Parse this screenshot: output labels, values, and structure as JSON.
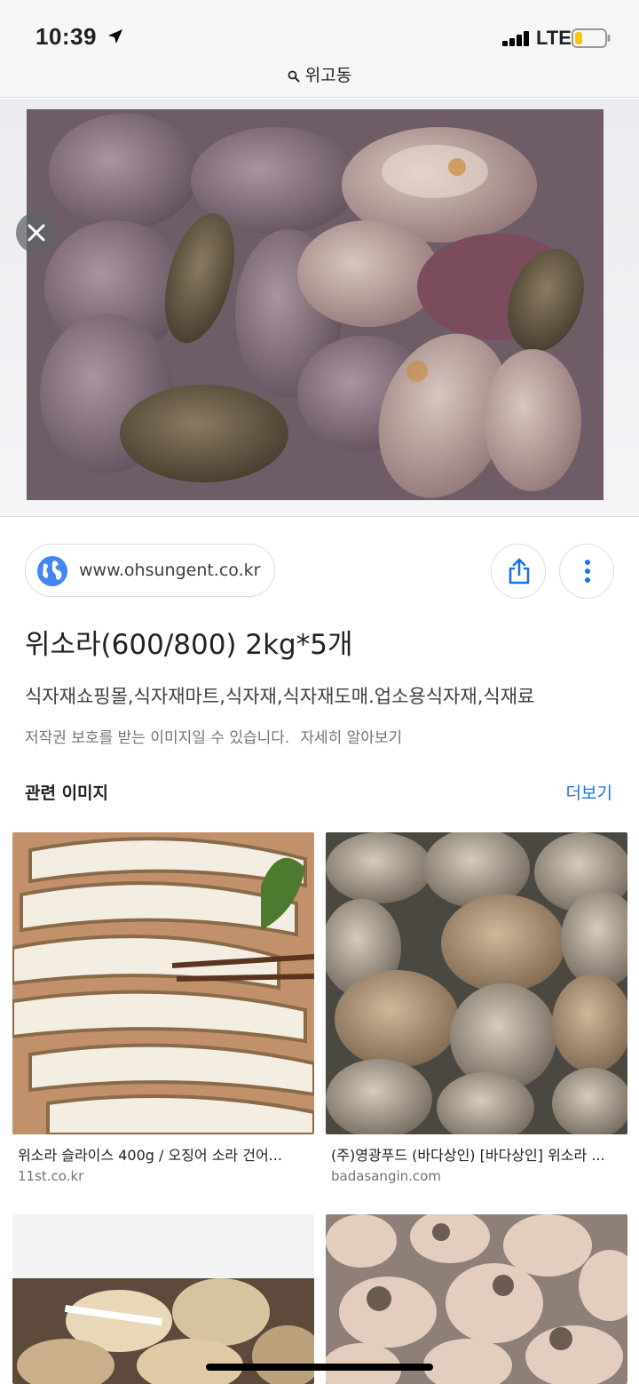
{
  "status_bar": {
    "time": "10:39",
    "carrier": "LTE",
    "battery_level": 0.25,
    "battery_color": "#f5c518"
  },
  "search": {
    "query": "위고동",
    "icon": "search-icon"
  },
  "result": {
    "source_url": "www.ohsungent.co.kr",
    "title": "위소라(600/800) 2kg*5개",
    "description": "식자재쇼핑몰,식자재마트,식자재,식자재도매.업소용식자재,식재료",
    "copyright_notice": "저작권 보호를 받는 이미지일 수 있습니다.",
    "learn_more": "자세히 알아보기"
  },
  "related": {
    "heading": "관련 이미지",
    "more_label": "더보기",
    "items": [
      {
        "title": "위소라 슬라이스 400g / 오징어 소라 건어...",
        "domain": "11st.co.kr"
      },
      {
        "title": "(주)영광푸드 (바다상인) [바다상인] 위소라 ...",
        "domain": "badasangin.com"
      },
      {
        "title": "",
        "domain": ""
      },
      {
        "title": "",
        "domain": ""
      }
    ]
  },
  "colors": {
    "link": "#1a73e8",
    "accent_blue": "#4285f4"
  }
}
